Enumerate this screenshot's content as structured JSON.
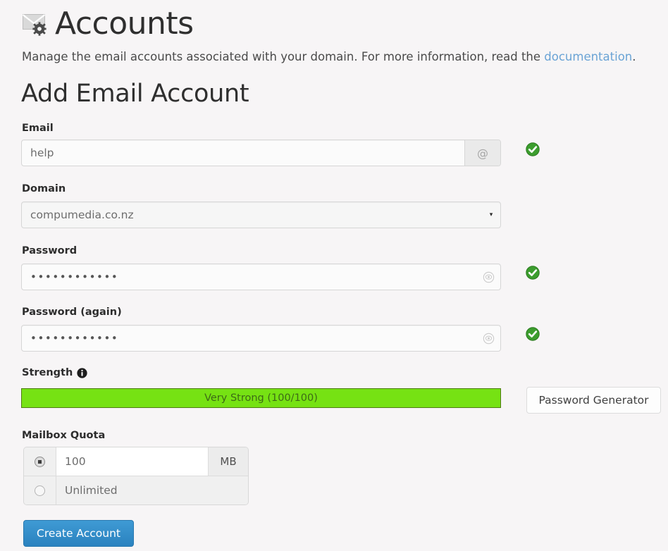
{
  "header": {
    "icon": "mail-settings-icon",
    "title": "Accounts",
    "subtitle_before": "Manage the email accounts associated with your domain. For more information, read the ",
    "subtitle_link": "documentation",
    "subtitle_after": "."
  },
  "form": {
    "section_title": "Add Email Account",
    "email": {
      "label": "Email",
      "value": "help",
      "placeholder": "help",
      "addon": "@",
      "valid": true
    },
    "domain": {
      "label": "Domain",
      "selected": "compumedia.co.nz",
      "caret": "▾"
    },
    "password": {
      "label": "Password",
      "value": "••••••••••••",
      "reveal_icon": "eye-icon",
      "valid": true
    },
    "password_again": {
      "label": "Password (again)",
      "value": "••••••••••••",
      "reveal_icon": "eye-icon",
      "valid": true
    },
    "strength": {
      "label": "Strength",
      "info_icon": "info-icon",
      "text": "Very Strong (100/100)",
      "score": 100,
      "max": 100,
      "percent": 100,
      "color": "#76e213"
    },
    "password_generator": {
      "label": "Password Generator"
    },
    "quota": {
      "label": "Mailbox Quota",
      "options": [
        {
          "selected": true,
          "value": "100",
          "unit": "MB"
        },
        {
          "selected": false,
          "value": "Unlimited",
          "unit": ""
        }
      ]
    },
    "submit": {
      "label": "Create Account"
    }
  },
  "colors": {
    "page_background": "#f7f5f6",
    "link": "#6aa3d5",
    "primary_button": "#2e8bc7",
    "strength_bar": "#76e213",
    "valid_badge": "#3c9d2e"
  }
}
